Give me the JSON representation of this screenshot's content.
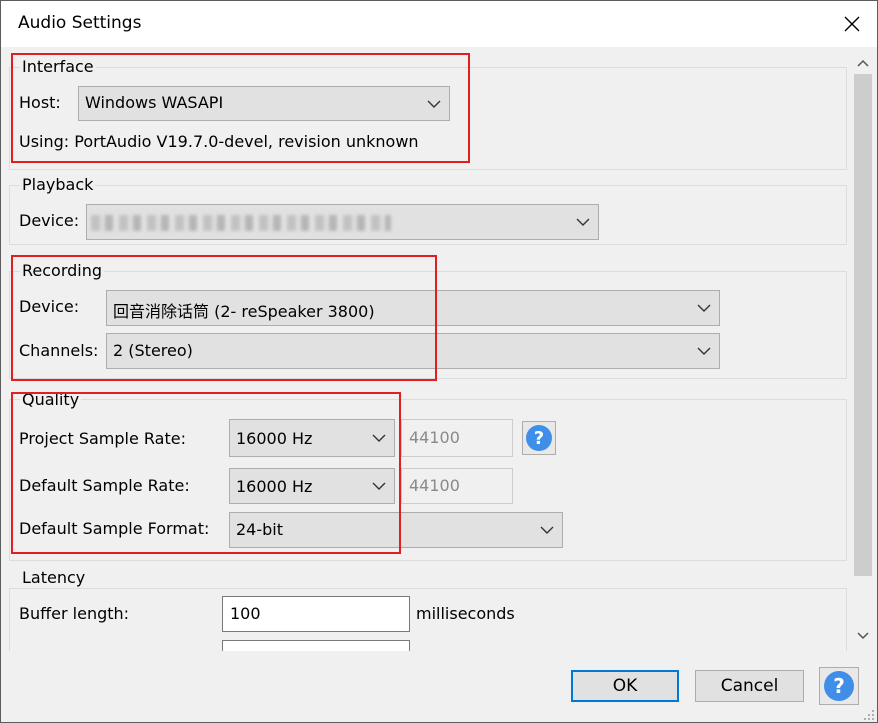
{
  "window": {
    "title": "Audio Settings"
  },
  "interface": {
    "group_label": "Interface",
    "host_label": "Host:",
    "host_value": "Windows WASAPI",
    "using_text": "Using: PortAudio V19.7.0-devel, revision unknown"
  },
  "playback": {
    "group_label": "Playback",
    "device_label": "Device:"
  },
  "recording": {
    "group_label": "Recording",
    "device_label": "Device:",
    "device_value": "回音消除话筒 (2- reSpeaker 3800)",
    "channels_label": "Channels:",
    "channels_value": "2 (Stereo)"
  },
  "quality": {
    "group_label": "Quality",
    "project_rate_label": "Project Sample Rate:",
    "project_rate_value": "16000 Hz",
    "project_rate_custom": "44100",
    "default_rate_label": "Default Sample Rate:",
    "default_rate_value": "16000 Hz",
    "default_rate_custom": "44100",
    "format_label": "Default Sample Format:",
    "format_value": "24-bit"
  },
  "latency": {
    "group_label": "Latency",
    "buffer_label": "Buffer length:",
    "buffer_value": "100",
    "buffer_unit": "milliseconds"
  },
  "footer": {
    "ok_label": "OK",
    "cancel_label": "Cancel"
  },
  "icons": {
    "help": "?",
    "help_color": "#3f8ee8",
    "highlight_color": "#e02020"
  }
}
